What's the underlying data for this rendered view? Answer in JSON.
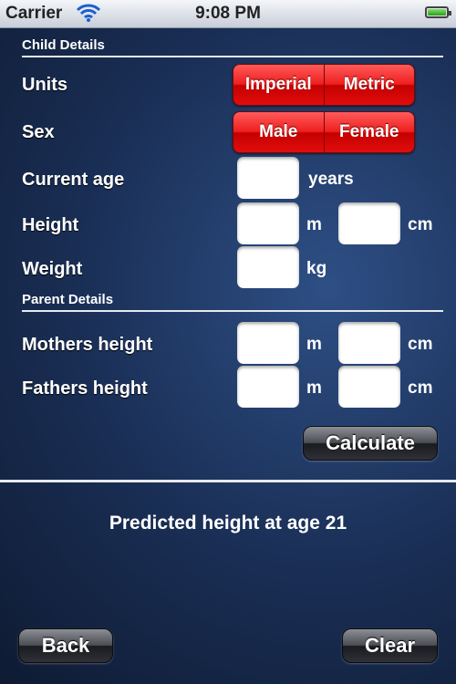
{
  "status": {
    "carrier": "Carrier",
    "time": "9:08 PM"
  },
  "child": {
    "section_title": "Child Details",
    "units_label": "Units",
    "units_options": [
      "Imperial",
      "Metric"
    ],
    "sex_label": "Sex",
    "sex_options": [
      "Male",
      "Female"
    ],
    "age_label": "Current age",
    "age_unit": "years",
    "height_label": "Height",
    "weight_label": "Weight",
    "weight_unit": "kg"
  },
  "parent": {
    "section_title": "Parent Details",
    "mother_label": "Mothers height",
    "father_label": "Fathers height"
  },
  "units": {
    "m": "m",
    "cm": "cm"
  },
  "buttons": {
    "calculate": "Calculate",
    "back": "Back",
    "clear": "Clear"
  },
  "result": {
    "text": "Predicted height at age 21"
  }
}
